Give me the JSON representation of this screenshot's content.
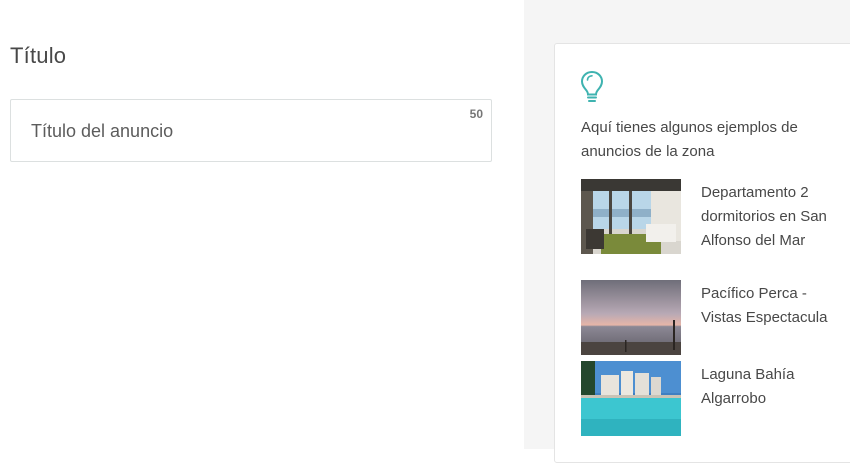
{
  "form": {
    "section_title": "Título",
    "title_field": {
      "placeholder": "Título del anuncio",
      "value": "",
      "char_count": "50"
    }
  },
  "tips": {
    "icon": "lightbulb-icon",
    "accent_color": "#3fb3b0",
    "text": "Aquí tienes algunos ejemplos de anuncios de la zona",
    "examples": [
      {
        "title": "Departamento 2 dormitorios en San Alfonso del Mar"
      },
      {
        "title": "Pacífico Perca - Vistas Espectacula"
      },
      {
        "title": "Laguna Bahía Algarrobo"
      }
    ]
  }
}
